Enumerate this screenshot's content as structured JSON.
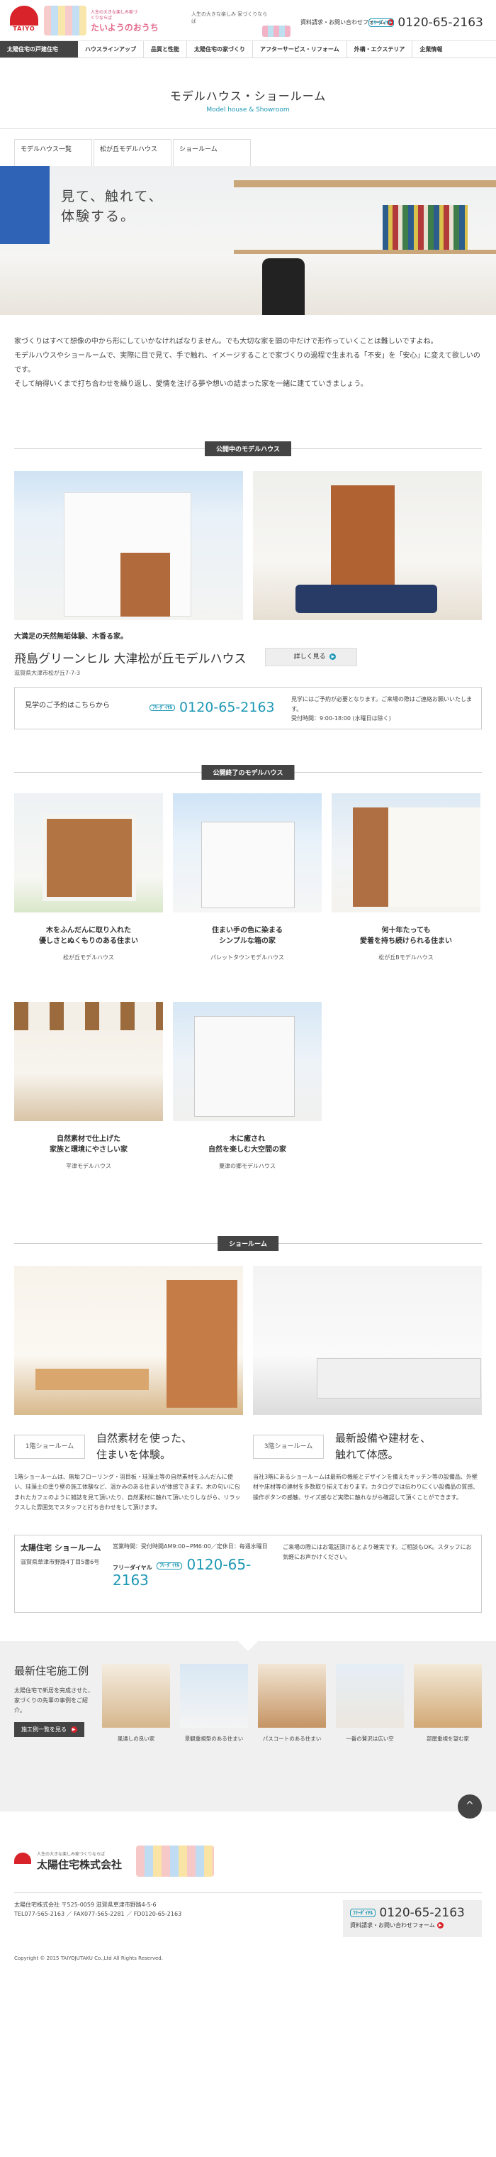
{
  "header": {
    "logo_text": "TAIYO",
    "brand_copy": "人生の大きな楽しみ家づくりならば",
    "brand_name": "たいようのおうち",
    "mid_copy": "人生の大きな楽しみ 家づくりならば",
    "contact_link": "資料請求・お問い合わせフォーム",
    "free_dial_label": "ﾌﾘｰﾀﾞｲﾔﾙ",
    "phone": "0120-65-2163"
  },
  "nav": {
    "active": "太陽住宅の戸建住宅",
    "items": [
      "ハウスラインアップ",
      "品質と性能",
      "太陽住宅の家づくり",
      "アフターサービス・リフォーム",
      "外構・エクステリア",
      "企業情報"
    ]
  },
  "page_title": {
    "main": "モデルハウス・ショールーム",
    "sub": "Model house & Showroom"
  },
  "sub_nav": [
    "モデルハウス一覧",
    "松が丘モデルハウス",
    "ショールーム"
  ],
  "hero": {
    "copy_line1": "見て、触れて、",
    "copy_line2": "体験する。"
  },
  "intro": {
    "p1": "家づくりはすべて想像の中から形にしていかなければなりません。でも大切な家を頭の中だけで形作っていくことは難しいですよね。",
    "p2": "モデルハウスやショールームで、実際に目で見て、手で触れ、イメージすることで家づくりの過程で生まれる「不安」を「安心」に変えて欲しいのです。",
    "p3": "そして納得いくまで打ち合わせを繰り返し、愛情を注げる夢や想いの詰まった家を一緒に建てていきましょう。"
  },
  "open_section": {
    "label": "公開中のモデルハウス",
    "catch": "大満足の天然無垢体験、木香る家。",
    "name": "飛島グリーンヒル 大津松が丘モデルハウス",
    "detail_button": "詳しく見る",
    "address": "滋賀県大津市松が丘7-7-3",
    "reserve_label": "見学のご予約はこちらから",
    "reserve_tel": "0120-65-2163",
    "note_line1": "見学にはご予約が必要となります。ご来場の際はご連絡お願いいたします。",
    "note_line2": "受付時間：9:00-18:00 (水曜日は除く)"
  },
  "closed_section": {
    "label": "公開終了のモデルハウス",
    "cards": [
      {
        "title1": "木をふんだんに取り入れた",
        "title2": "優しさとぬくもりのある住まい",
        "place": "松が丘モデルハウス"
      },
      {
        "title1": "住まい手の色に染まる",
        "title2": "シンプルな箱の家",
        "place": "パレットタウンモデルハウス"
      },
      {
        "title1": "何十年たっても",
        "title2": "愛着を持ち続けられる住まい",
        "place": "松が丘Bモデルハウス"
      },
      {
        "title1": "自然素材で仕上げた",
        "title2": "家族と環境にやさしい家",
        "place": "平津モデルハウス"
      },
      {
        "title1": "木に癒され",
        "title2": "自然を楽しむ大空間の家",
        "place": "粟津の郷モデルハウス"
      }
    ]
  },
  "showroom": {
    "label": "ショールーム",
    "col1": {
      "tag": "1階ショールーム",
      "catch1": "自然素材を使った、",
      "catch2": "住まいを体験。",
      "desc": "1階ショールームは、無垢フローリング・羽目板・珪藻土等の自然素材をふんだんに使い、珪藻土の塗り壁の施工体験など、温かみのある住まいが体感できます。木の句いに包まれたカフェのように雑誌を見て頂いたり、自然素材に触れて頂いたりしながら、リラックスした雰囲気でスタッフと打ち合わせをして頂けます。"
    },
    "col2": {
      "tag": "3階ショールーム",
      "catch1": "最新設備や建材を、",
      "catch2": "触れて体感。",
      "desc": "当社3階にあるショールームは最新の機能とデザインを備えたキッチン等の設備品、外壁材や床材等の建材を多数取り揃えております。カタログでは伝わりにくい設備品の質感、操作ボタンの感触、サイズ感など実際に触れながら確認して頂くことができます。"
    },
    "box": {
      "name": "太陽住宅 ショールーム",
      "address": "滋賀県草津市野路4丁目5番6号",
      "hours": "営業時間：受付時間AM9:00~PM6:00／定休日：毎週水曜日",
      "tel_label": "フリーダイヤル",
      "tel": "0120-65-2163",
      "note": "ご来場の際にはお電話頂けるとより確実です。ご相談もOK。スタッフにお気軽にお声かけください。"
    }
  },
  "examples": {
    "title": "最新住宅施工例",
    "desc": "太陽住宅で新居を完成させた、家づくりの先輩の事例をご紹介。",
    "button": "施工例一覧を見る",
    "items": [
      "風通しの良い家",
      "景観重視型のある住まい",
      "パスコートのある住まい",
      "一番の贅沢は広い空",
      "部屋重視を望む家"
    ],
    "to_top": "^"
  },
  "footer": {
    "small_copy": "人生の大きな楽しみ家づくりならば",
    "company": "太陽住宅株式会社",
    "addr1": "太陽住宅株式会社 〒525-0059 滋賀県草津市野路4-5-6",
    "addr2": "TEL077-565-2163 ／ FAX077-565-2281 ／ FD0120-65-2163",
    "phone": "0120-65-2163",
    "contact_link": "資料請求・お問い合わせフォーム",
    "copyright": "Copyright © 2015 TAIYOJUTAKU Co.,Ltd All Rights Reserved."
  },
  "colors": {
    "accent": "#1e98b5",
    "brand_red": "#d8232a",
    "dark": "#444444"
  }
}
